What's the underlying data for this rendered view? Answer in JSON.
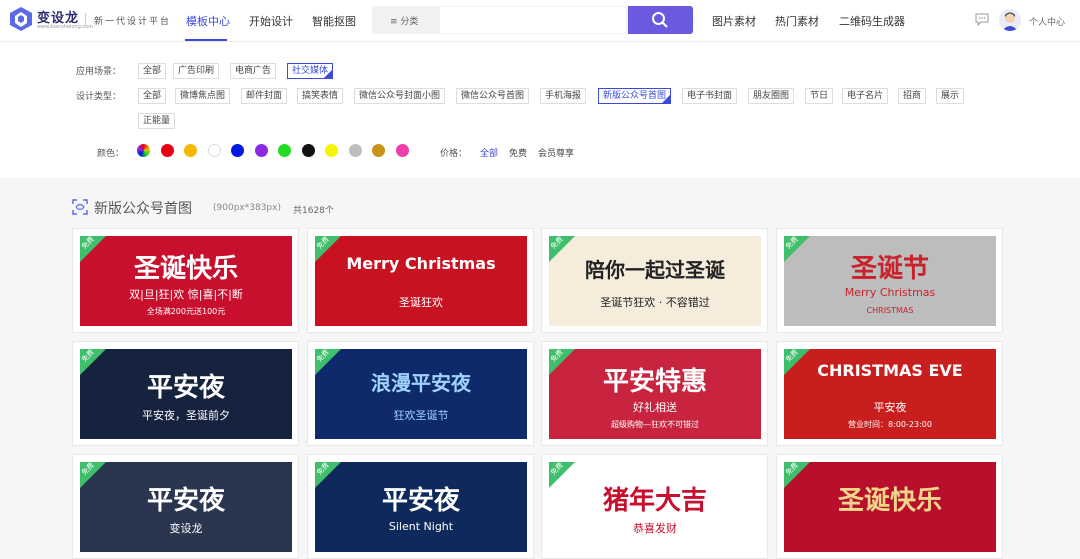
{
  "header": {
    "logo_text": "变设龙",
    "logo_sub": "www.bianshelong.com",
    "slogan": "新一代设计平台",
    "nav": [
      {
        "label": "模板中心",
        "active": true
      },
      {
        "label": "开始设计",
        "active": false
      },
      {
        "label": "智能抠图",
        "active": false
      }
    ],
    "search": {
      "category": "分类",
      "placeholder": ""
    },
    "links": [
      "图片素材",
      "热门素材",
      "二维码生成器"
    ],
    "user_center": "个人中心"
  },
  "filters": {
    "scene_label": "应用场景：",
    "scene_tags": [
      {
        "label": "全部",
        "active": false
      },
      {
        "label": "广告印刷",
        "active": false
      },
      {
        "label": "电商广告",
        "active": false
      },
      {
        "label": "社交媒体",
        "active": true
      }
    ],
    "type_label": "设计类型：",
    "type_tags_row1": [
      {
        "label": "全部",
        "active": false
      },
      {
        "label": "微博焦点图",
        "active": false
      },
      {
        "label": "邮件封面",
        "active": false
      },
      {
        "label": "搞笑表情",
        "active": false
      },
      {
        "label": "微信公众号封面小图",
        "active": false
      },
      {
        "label": "微信公众号首图",
        "active": false
      },
      {
        "label": "手机海报",
        "active": false
      },
      {
        "label": "新版公众号首图",
        "active": true
      },
      {
        "label": "电子书封面",
        "active": false
      },
      {
        "label": "朋友圈图",
        "active": false
      },
      {
        "label": "节日",
        "active": false
      },
      {
        "label": "电子名片",
        "active": false
      },
      {
        "label": "招商",
        "active": false
      },
      {
        "label": "展示",
        "active": false
      }
    ],
    "type_tags_row2": [
      {
        "label": "正能量",
        "active": false
      }
    ],
    "color_label": "颜色：",
    "colors": [
      "rainbow",
      "#e60012",
      "#f5b800",
      "#ffffff",
      "#0019e0",
      "#8a2be2",
      "#22dd22",
      "#111111",
      "#f5f500",
      "#bdbdbd",
      "#c8941a",
      "#f03ca8"
    ],
    "price_label": "价格：",
    "price_options": [
      {
        "label": "全部",
        "active": true
      },
      {
        "label": "免费",
        "active": false
      },
      {
        "label": "会员尊享",
        "active": false
      }
    ]
  },
  "section": {
    "title": "新版公众号首图",
    "size": "(900px*383px)",
    "count": "共1628个"
  },
  "cards": [
    {
      "badge": "免费",
      "title": "圣诞快乐",
      "sub": "双|旦|狂|欢  惊|喜|不|断",
      "sub2": "全场满200元送100元",
      "bg": "#c8102e",
      "fg": "#ffffff"
    },
    {
      "badge": "免费",
      "title": "Merry Christmas",
      "sub": "圣诞狂欢",
      "sub2": "",
      "bg": "#c81222",
      "fg": "#ffffff"
    },
    {
      "badge": "免费",
      "title": "陪你一起过圣诞",
      "sub": "圣诞节狂欢 · 不容错过",
      "sub2": "",
      "bg": "#f5ecdc",
      "fg": "#222222"
    },
    {
      "badge": "免费",
      "title": "圣诞节",
      "sub": "Merry Christmas",
      "sub2": "CHRISTMAS",
      "bg": "#bdbdbd",
      "fg": "#c8232c"
    },
    {
      "badge": "免费",
      "title": "平安夜",
      "sub": "平安夜，圣诞前夕",
      "sub2": "",
      "bg": "#15233f",
      "fg": "#ffffff"
    },
    {
      "badge": "免费",
      "title": "浪漫平安夜",
      "sub": "狂欢圣诞节",
      "sub2": "",
      "bg": "#0f2a6b",
      "fg": "#9fd4ff"
    },
    {
      "badge": "免费",
      "title": "平安特惠",
      "sub": "好礼相送",
      "sub2": "超级购物—狂欢不可错过",
      "bg": "#c8243f",
      "fg": "#ffffff"
    },
    {
      "badge": "免费",
      "title": "CHRISTMAS EVE",
      "sub": "平安夜",
      "sub2": "营业时间：8:00-23:00",
      "bg": "#c81e1e",
      "fg": "#ffffff"
    },
    {
      "badge": "免费",
      "title": "平安夜",
      "sub": "变设龙",
      "sub2": "",
      "bg": "#2a3550",
      "fg": "#ffffff"
    },
    {
      "badge": "免费",
      "title": "平安夜",
      "sub": "Silent Night",
      "sub2": "",
      "bg": "#0e2a5c",
      "fg": "#ffffff"
    },
    {
      "badge": "免费",
      "title": "猪年大吉",
      "sub": "恭喜发财",
      "sub2": "",
      "bg": "#ffffff",
      "fg": "#c8102e"
    },
    {
      "badge": "免费",
      "title": "圣诞快乐",
      "sub": "",
      "sub2": "",
      "bg": "#b8102c",
      "fg": "#f0d68a"
    }
  ]
}
